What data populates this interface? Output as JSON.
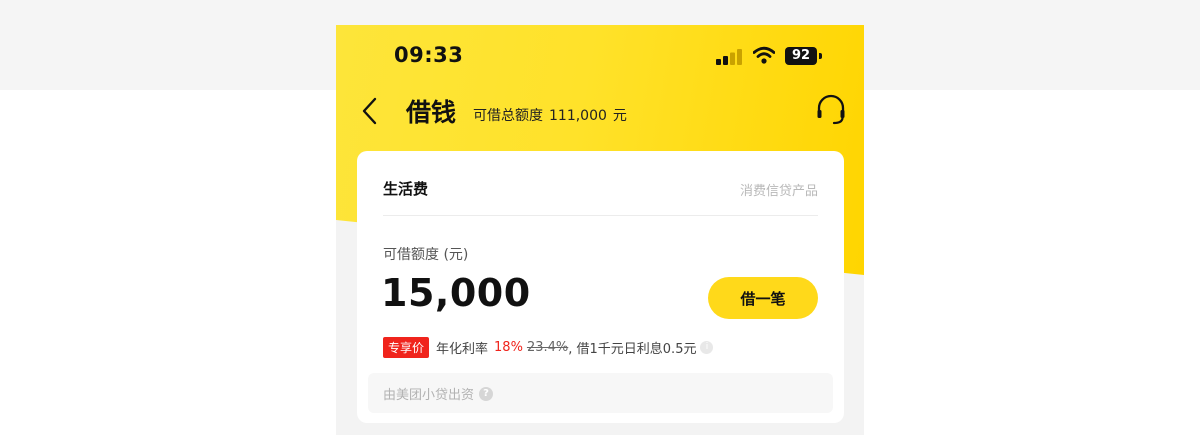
{
  "status_bar": {
    "time": "09:33",
    "battery": "92",
    "icons": [
      "signal-icon",
      "wifi-icon",
      "battery-icon"
    ]
  },
  "header": {
    "title": "借钱",
    "credit_label": "可借总额度",
    "credit_amount": "111,000",
    "credit_unit": "元",
    "icons": [
      "back-arrow-icon",
      "headset-icon"
    ]
  },
  "card": {
    "product_name": "生活费",
    "product_type": "消费信贷产品",
    "limit_label": "可借额度 (元)",
    "limit_amount": "15,000",
    "borrow_button": "借一笔",
    "promo_badge": "专享价",
    "rate_label": "年化利率",
    "rate_current": "18%",
    "rate_original": "23.4%",
    "rate_tail": ", 借1千元日利息0.5元",
    "lender_text": "由美团小贷出资"
  },
  "colors": {
    "brand_yellow": "#ffd91a",
    "promo_red": "#f0241c"
  }
}
